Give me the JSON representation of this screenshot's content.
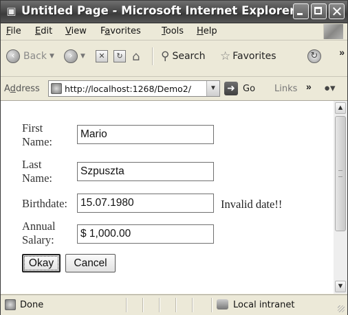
{
  "window": {
    "title": "Untitled Page - Microsoft Internet Explorer"
  },
  "menu": {
    "items": [
      {
        "label": "File",
        "key": "F",
        "rest": "ile"
      },
      {
        "label": "Edit",
        "key": "E",
        "rest": "dit"
      },
      {
        "label": "View",
        "key": "V",
        "rest": "iew"
      },
      {
        "label": "Favorites",
        "pre": "F",
        "key": "a",
        "rest": "vorites"
      },
      {
        "label": "Tools",
        "key": "T",
        "rest": "ools"
      },
      {
        "label": "Help",
        "key": "H",
        "rest": "elp"
      }
    ]
  },
  "toolbar": {
    "back_label": "Back",
    "search_label": "Search",
    "favorites_label": "Favorites"
  },
  "address": {
    "label_key": "d",
    "label_pre": "A",
    "label_rest": "dress",
    "url": "http://localhost:1268/Demo2/",
    "go_label": "Go",
    "links_label": "Links"
  },
  "form": {
    "first_name_label_1": "First",
    "first_name_label_2": "Name:",
    "first_name_value": "Mario",
    "last_name_label_1": "Last",
    "last_name_label_2": "Name:",
    "last_name_value": "Szpuszta",
    "birthdate_label": "Birthdate:",
    "birthdate_value": "15.07.1980",
    "birthdate_error": "Invalid date!!",
    "salary_label_1": "Annual",
    "salary_label_2": "Salary:",
    "salary_value": "$ 1,000.00",
    "okay_label": "Okay",
    "cancel_label": "Cancel"
  },
  "status": {
    "text": "Done",
    "zone": "Local intranet"
  },
  "icons": {
    "app": "ie-icon",
    "back": "back-arrow-icon",
    "forward": "forward-arrow-icon",
    "stop": "stop-icon",
    "refresh": "refresh-icon",
    "home": "home-icon",
    "search": "search-icon",
    "favorites": "star-icon",
    "history": "history-icon"
  }
}
